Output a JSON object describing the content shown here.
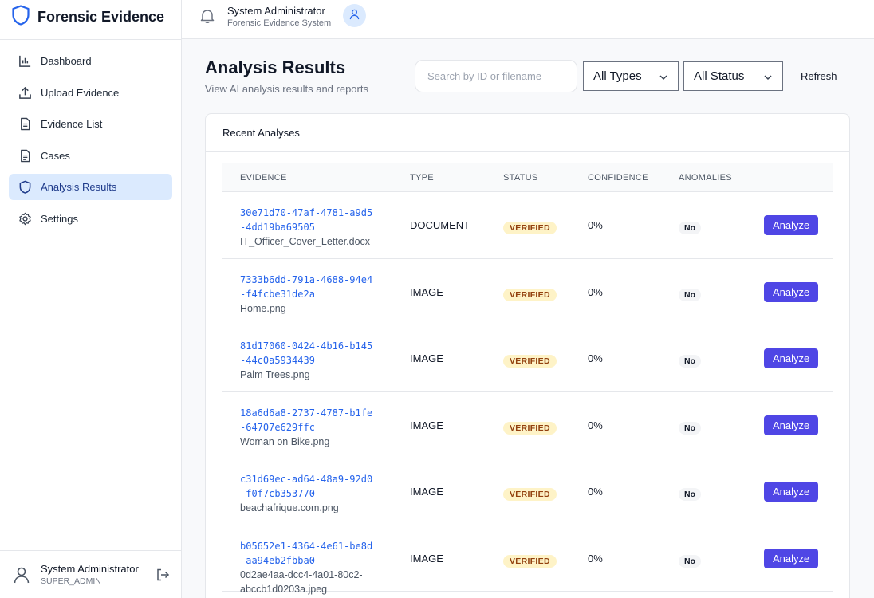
{
  "app": {
    "brand": "Forensic Evidence"
  },
  "sidebar": {
    "items": [
      {
        "label": "Dashboard",
        "icon": "bar-chart-icon"
      },
      {
        "label": "Upload Evidence",
        "icon": "upload-icon"
      },
      {
        "label": "Evidence List",
        "icon": "file-text-icon"
      },
      {
        "label": "Cases",
        "icon": "document-icon"
      },
      {
        "label": "Analysis Results",
        "icon": "shield-icon",
        "active": true
      },
      {
        "label": "Settings",
        "icon": "gear-icon"
      }
    ],
    "footer": {
      "name": "System Administrator",
      "role": "SUPER_ADMIN"
    }
  },
  "header": {
    "user_name": "System Administrator",
    "system": "Forensic Evidence System"
  },
  "page": {
    "title": "Analysis Results",
    "subtitle": "View AI analysis results and reports",
    "search_placeholder": "Search by ID or filename",
    "type_filter": "All Types",
    "status_filter": "All Status",
    "refresh_label": "Refresh"
  },
  "card": {
    "title": "Recent Analyses"
  },
  "table": {
    "columns": [
      "EVIDENCE",
      "TYPE",
      "STATUS",
      "CONFIDENCE",
      "ANOMALIES"
    ],
    "action_label": "Analyze",
    "rows": [
      {
        "id": "30e71d70-47af-4781-a9d5-4dd19ba69505",
        "file": "IT_Officer_Cover_Letter.docx",
        "type": "DOCUMENT",
        "status": "VERIFIED",
        "confidence": "0%",
        "anomalies": "No"
      },
      {
        "id": "7333b6dd-791a-4688-94e4-f4fcbe31de2a",
        "file": "Home.png",
        "type": "IMAGE",
        "status": "VERIFIED",
        "confidence": "0%",
        "anomalies": "No"
      },
      {
        "id": "81d17060-0424-4b16-b145-44c0a5934439",
        "file": "Palm Trees.png",
        "type": "IMAGE",
        "status": "VERIFIED",
        "confidence": "0%",
        "anomalies": "No"
      },
      {
        "id": "18a6d6a8-2737-4787-b1fe-64707e629ffc",
        "file": "Woman on Bike.png",
        "type": "IMAGE",
        "status": "VERIFIED",
        "confidence": "0%",
        "anomalies": "No"
      },
      {
        "id": "c31d69ec-ad64-48a9-92d0-f0f7cb353770",
        "file": "beachafrique.com.png",
        "type": "IMAGE",
        "status": "VERIFIED",
        "confidence": "0%",
        "anomalies": "No"
      },
      {
        "id": "b05652e1-4364-4e61-be8d-aa94eb2fbba0",
        "file": "0d2ae4aa-dcc4-4a01-80c2-abccb1d0203a.jpeg",
        "type": "IMAGE",
        "status": "VERIFIED",
        "confidence": "0%",
        "anomalies": "No"
      }
    ]
  },
  "colors": {
    "accent": "#4f46e5",
    "link": "#2563eb",
    "active_nav": "#dbeafe",
    "badge_bg": "#fef3c7",
    "badge_text": "#92400e"
  }
}
